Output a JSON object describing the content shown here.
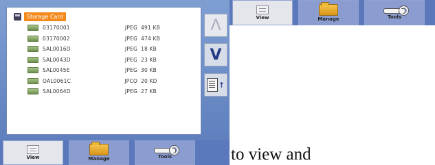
{
  "storage": {
    "label": "Storage Card"
  },
  "files": [
    {
      "name": "03170001",
      "type": "JPEG",
      "size": "491 KB"
    },
    {
      "name": "03170002",
      "type": "JPEG",
      "size": "474 KB"
    },
    {
      "name": "SAL0016D",
      "type": "JPEG",
      "size": "18 KB"
    },
    {
      "name": "SAL0043D",
      "type": "JPEG",
      "size": "23 KB"
    },
    {
      "name": "SAL0045E",
      "type": "JPEG",
      "size": "30 KB"
    },
    {
      "name": "OAL0061C",
      "type": "JPCO",
      "size": "20 KD"
    },
    {
      "name": "SAL0064D",
      "type": "JPEG",
      "size": "27 KB"
    }
  ],
  "scroll": {
    "up_glyph": "Λ",
    "down_glyph": "V",
    "props_arrow": "↑"
  },
  "toolbar": {
    "view_label": "View",
    "manage_label": "Manage",
    "tools_label": "Tools"
  },
  "caption": {
    "text": "to view and"
  },
  "colors": {
    "accent": "#f48a1c",
    "frame": "#5b78bd",
    "down_arrow": "#233a85"
  },
  "icons": {
    "storage": "storage-card-icon",
    "file": "image-file-icon",
    "view": "view-icon",
    "manage": "folder-icon",
    "tools": "wrench-icon",
    "properties": "properties-icon"
  }
}
